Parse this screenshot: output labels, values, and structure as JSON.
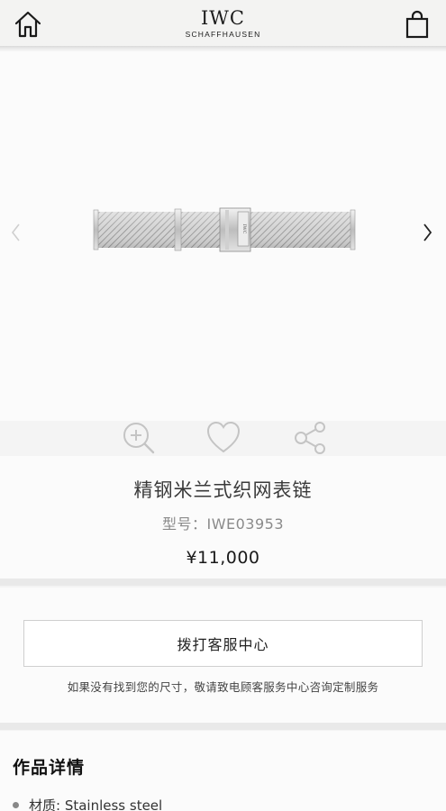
{
  "header": {
    "brand": "IWC",
    "brand_sub": "SCHAFFHAUSEN",
    "home_icon": "home-icon",
    "cart_icon": "shopping-bag-icon"
  },
  "gallery": {
    "prev_icon": "chevron-left-icon",
    "next_icon": "chevron-right-icon",
    "image_alt": "Milanese mesh stainless steel bracelet",
    "clasp_text": "IWC"
  },
  "actions": {
    "zoom_icon": "zoom-in-icon",
    "favorite_icon": "heart-icon",
    "share_icon": "share-icon"
  },
  "product": {
    "name": "精钢米兰式织网表链",
    "model": "型号：IWE03953",
    "price": "¥11,000"
  },
  "service": {
    "call_button": "拨打客服中心",
    "note": "如果没有找到您的尺寸，敬请致电顾客服务中心咨询定制服务"
  },
  "details": {
    "title": "作品详情",
    "items": [
      {
        "label": "材质: Stainless steel"
      }
    ]
  },
  "colors": {
    "header_bg": "#f3f3f2",
    "page_bg": "#fbfbfb",
    "divider": "#e9e9e9",
    "icon_light": "#c4c4c4"
  }
}
